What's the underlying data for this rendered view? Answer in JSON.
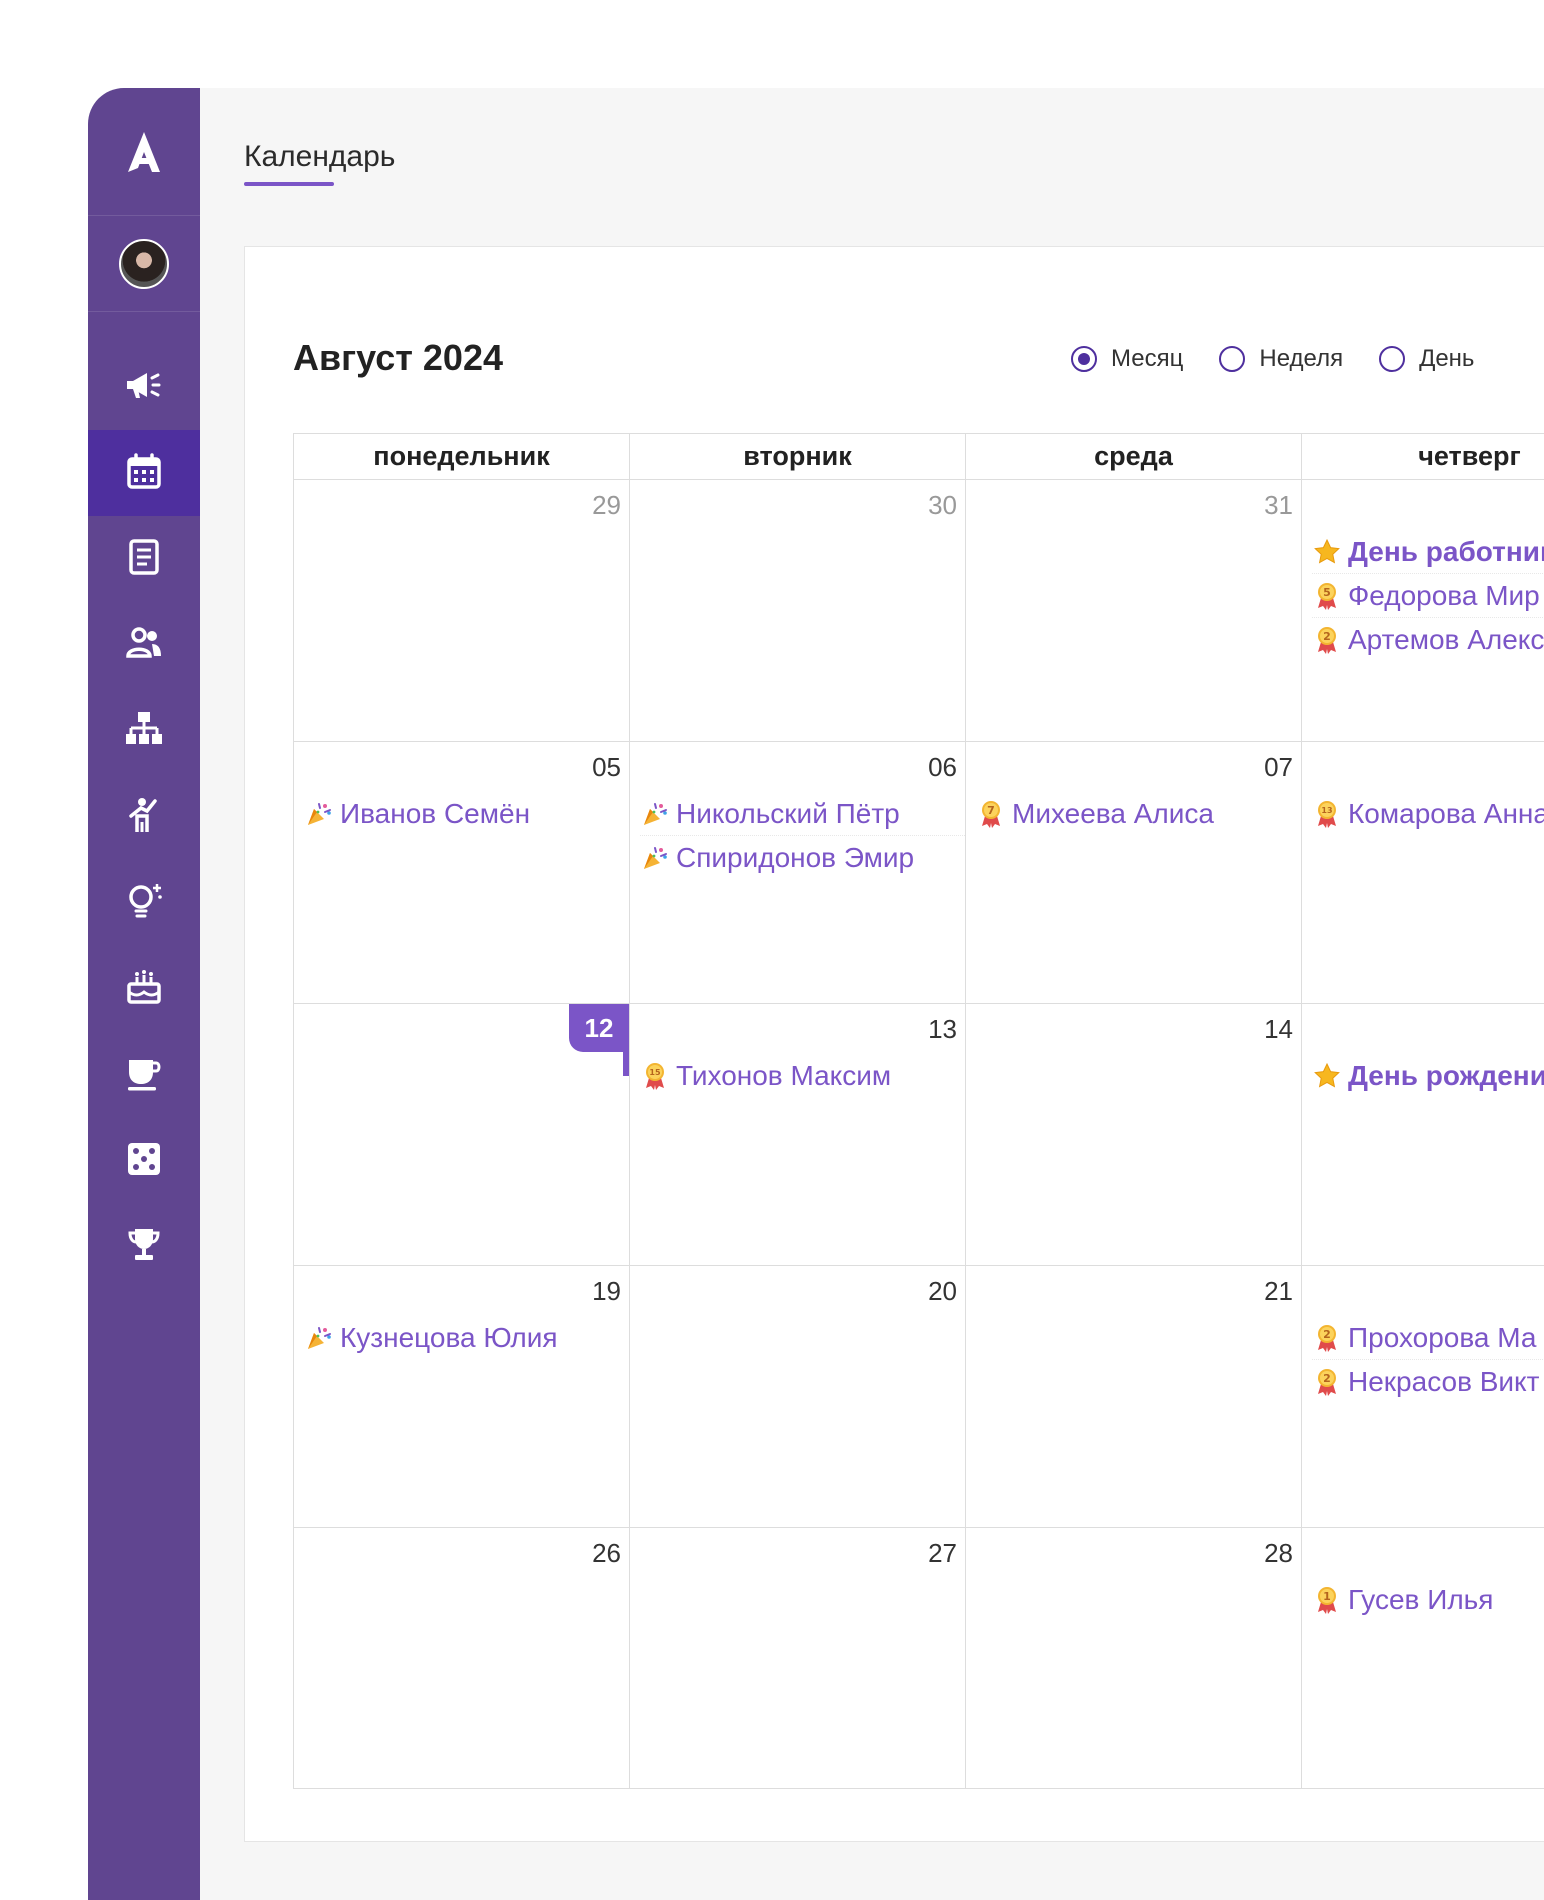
{
  "app": {
    "page_title": "Календарь",
    "accent_color": "#604590",
    "active_color": "#4e2f9e",
    "link_color": "#7b55c7"
  },
  "sidebar": {
    "logo_icon": "logo-icon",
    "items": [
      {
        "icon": "megaphone-icon",
        "active": false
      },
      {
        "icon": "calendar-icon",
        "active": true
      },
      {
        "icon": "document-icon",
        "active": false
      },
      {
        "icon": "users-icon",
        "active": false
      },
      {
        "icon": "org-structure-icon",
        "active": false
      },
      {
        "icon": "activity-icon",
        "active": false
      },
      {
        "icon": "idea-icon",
        "active": false
      },
      {
        "icon": "cake-icon",
        "active": false
      },
      {
        "icon": "coffee-icon",
        "active": false
      },
      {
        "icon": "dice-icon",
        "active": false
      },
      {
        "icon": "trophy-icon",
        "active": false
      }
    ]
  },
  "calendar": {
    "month_title": "Август 2024",
    "views": [
      {
        "label": "Месяц",
        "checked": true
      },
      {
        "label": "Неделя",
        "checked": false
      },
      {
        "label": "День",
        "checked": false
      }
    ],
    "weekdays": [
      "понедельник",
      "вторник",
      "среда",
      "четверг"
    ],
    "weeks": [
      [
        {
          "day": "29",
          "muted": true,
          "events": []
        },
        {
          "day": "30",
          "muted": true,
          "events": []
        },
        {
          "day": "31",
          "muted": true,
          "events": []
        },
        {
          "day": "",
          "events": [
            {
              "type": "star",
              "text": "День работника",
              "bold": true
            },
            {
              "type": "medal",
              "badge": "5",
              "text": "Федорова Мир"
            },
            {
              "type": "medal",
              "badge": "2",
              "text": "Артемов Алекс"
            }
          ]
        }
      ],
      [
        {
          "day": "05",
          "events": [
            {
              "type": "party",
              "text": "Иванов Семён"
            }
          ]
        },
        {
          "day": "06",
          "events": [
            {
              "type": "party",
              "text": "Никольский Пётр"
            },
            {
              "type": "party",
              "text": "Спиридонов Эмир"
            }
          ]
        },
        {
          "day": "07",
          "events": [
            {
              "type": "medal",
              "badge": "7",
              "text": "Михеева Алиса"
            }
          ]
        },
        {
          "day": "",
          "events": [
            {
              "type": "medal",
              "badge": "13",
              "text": "Комарова Анна"
            }
          ]
        }
      ],
      [
        {
          "day": "12",
          "today": true,
          "events": []
        },
        {
          "day": "13",
          "events": [
            {
              "type": "medal",
              "badge": "15",
              "text": "Тихонов Максим"
            }
          ]
        },
        {
          "day": "14",
          "events": []
        },
        {
          "day": "",
          "events": [
            {
              "type": "star",
              "text": "День рождения",
              "bold": true
            }
          ]
        }
      ],
      [
        {
          "day": "19",
          "events": [
            {
              "type": "party",
              "text": "Кузнецова Юлия"
            }
          ]
        },
        {
          "day": "20",
          "events": []
        },
        {
          "day": "21",
          "events": []
        },
        {
          "day": "",
          "events": [
            {
              "type": "medal",
              "badge": "2",
              "text": "Прохорова Ма"
            },
            {
              "type": "medal",
              "badge": "2",
              "text": "Некрасов Викт"
            }
          ]
        }
      ],
      [
        {
          "day": "26",
          "events": []
        },
        {
          "day": "27",
          "events": []
        },
        {
          "day": "28",
          "events": []
        },
        {
          "day": "",
          "events": [
            {
              "type": "medal",
              "badge": "1",
              "text": "Гусев Илья"
            }
          ]
        }
      ]
    ]
  }
}
